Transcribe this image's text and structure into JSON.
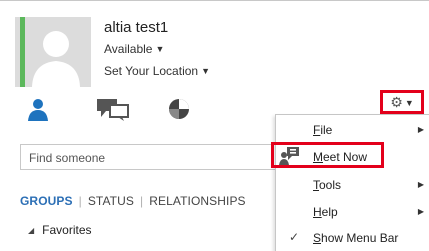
{
  "profile": {
    "name": "altia test1",
    "status": "Available",
    "location": "Set Your Location"
  },
  "colors": {
    "presence": "#5cb85c",
    "accent": "#2c6fb5",
    "highlight": "#e3001b"
  },
  "nav_icons": [
    "contacts-icon",
    "conversations-icon",
    "meetings-icon"
  ],
  "search": {
    "placeholder": "Find someone"
  },
  "tabs": [
    {
      "label": "GROUPS",
      "active": true
    },
    {
      "label": "STATUS",
      "active": false
    },
    {
      "label": "RELATIONSHIPS",
      "active": false
    }
  ],
  "group": {
    "label": "Favorites"
  },
  "options_menu": {
    "button_icon": "gear-icon",
    "items": [
      {
        "label": "File",
        "accel": "F",
        "rest": "ile",
        "submenu": true
      },
      {
        "label": "Meet Now",
        "accel": "M",
        "rest": "eet Now",
        "submenu": false,
        "icon": "meet-now-icon"
      },
      {
        "label": "Tools",
        "accel": "T",
        "rest": "ools",
        "submenu": true
      },
      {
        "label": "Help",
        "accel": "H",
        "rest": "elp",
        "submenu": true
      },
      {
        "label": "Show Menu Bar",
        "accel": "S",
        "rest": "how Menu Bar",
        "submenu": false,
        "checked": true
      }
    ]
  }
}
